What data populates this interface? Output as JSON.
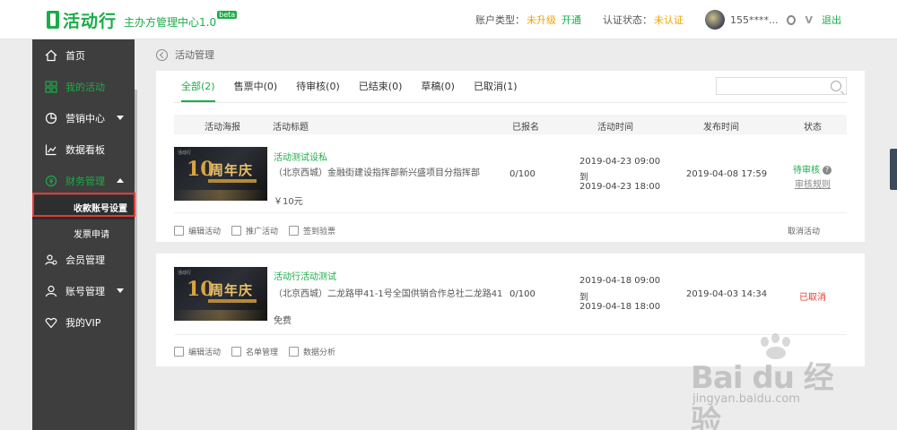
{
  "header": {
    "logo_text": "活动行",
    "logo_sub": "主办方管理中心1.0",
    "beta": "beta",
    "account_type_label": "账户类型：",
    "account_type_value": "未升级",
    "upgrade_link": "开通",
    "cert_label": "认证状态：",
    "cert_value": "未认证",
    "user_name": "155****...",
    "vip": "V",
    "logout": "退出"
  },
  "sidebar": {
    "items": [
      {
        "label": "首页"
      },
      {
        "label": "我的活动"
      },
      {
        "label": "营销中心"
      },
      {
        "label": "数据看板"
      },
      {
        "label": "财务管理"
      },
      {
        "label": "收款账号设置"
      },
      {
        "label": "发票申请"
      },
      {
        "label": "会员管理"
      },
      {
        "label": "账号管理"
      },
      {
        "label": "我的VIP"
      }
    ]
  },
  "breadcrumb": "活动管理",
  "tabs": [
    {
      "label": "全部(2)"
    },
    {
      "label": "售票中(0)"
    },
    {
      "label": "待审核(0)"
    },
    {
      "label": "已结束(0)"
    },
    {
      "label": "草稿(0)"
    },
    {
      "label": "已取消(1)"
    }
  ],
  "search": {
    "placeholder": ""
  },
  "table_headers": {
    "poster": "活动海报",
    "title": "活动标题",
    "registered": "已报名",
    "time": "活动时间",
    "publish": "发布时间",
    "status": "状态"
  },
  "activities": [
    {
      "poster_big": "10",
      "poster_zh": "周年庆",
      "title": "活动测试设私",
      "address": "（北京西城）金融街建设指挥部新兴盛项目分指挥部",
      "price": "￥10元",
      "registered": "0/100",
      "time_start": "2019-04-23 09:00",
      "time_to": "到",
      "time_end": "2019-04-23 18:00",
      "publish": "2019-04-08 17:59",
      "status": "待审核",
      "status_help": "?",
      "rule": "审核规则",
      "actions": [
        "编辑活动",
        "推广活动",
        "签到验票"
      ],
      "cancel": "取消活动"
    },
    {
      "poster_big": "10",
      "poster_zh": "周年庆",
      "title": "活动行活动测试",
      "address": "（北京西城）二龙路甲41-1号全国供销合作总社二龙路41",
      "price": "免费",
      "registered": "0/100",
      "time_start": "2019-04-18 09:00",
      "time_to": "到",
      "time_end": "2019-04-18 18:00",
      "publish": "2019-04-03 14:34",
      "status": "已取消",
      "actions": [
        "编辑活动",
        "名单管理",
        "数据分析"
      ]
    }
  ],
  "watermark": {
    "brand": "Bai du 经验",
    "url": "jingyan.baidu.com"
  },
  "colors": {
    "brand": "#1aad47",
    "warning": "#f0a500",
    "danger": "#e53935",
    "sidebar": "#3e3e3e"
  }
}
